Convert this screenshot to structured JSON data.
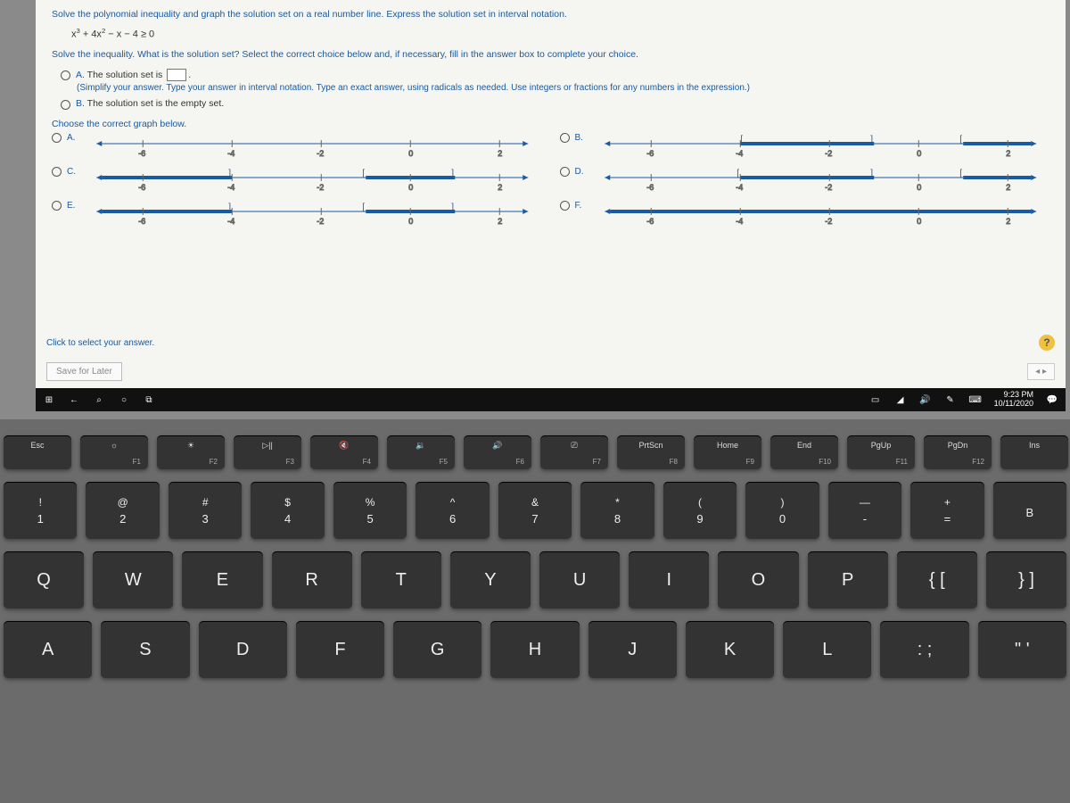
{
  "question": {
    "prompt": "Solve the polynomial inequality and graph the solution set on a real number line. Express the solution set in interval notation.",
    "equation_html": "x³ + 4x² − x − 4 ≥ 0",
    "sub_prompt": "Solve the inequality. What is the solution set? Select the correct choice below and, if necessary, fill in the answer box to complete your choice.",
    "choices": {
      "A_label": "A.",
      "A_text": "The solution set is",
      "A_hint": "(Simplify your answer. Type your answer in interval notation. Type an exact answer, using radicals as needed. Use integers or fractions for any numbers in the expression.)",
      "B_label": "B.",
      "B_text": "The solution set is the empty set."
    },
    "choose_graph": "Choose the correct graph below.",
    "graph_labels": {
      "A": "A.",
      "B": "B.",
      "C": "C.",
      "D": "D.",
      "E": "E.",
      "F": "F."
    },
    "axis_ticks": [
      -6,
      -4,
      -2,
      0,
      2
    ]
  },
  "footer": {
    "click_select": "Click to select your answer.",
    "save_later": "Save for Later",
    "help": "?",
    "nav": "◂  ▸"
  },
  "taskbar": {
    "time": "9:23 PM",
    "date": "10/11/2020"
  },
  "keyboard": {
    "fn": [
      {
        "top": "Esc",
        "sub": ""
      },
      {
        "top": "☼",
        "sub": "F1"
      },
      {
        "top": "☀",
        "sub": "F2"
      },
      {
        "top": "▷||",
        "sub": "F3"
      },
      {
        "top": "🔇",
        "sub": "F4"
      },
      {
        "top": "🔉",
        "sub": "F5"
      },
      {
        "top": "🔊",
        "sub": "F6"
      },
      {
        "top": "⎚",
        "sub": "F7"
      },
      {
        "top": "PrtScn",
        "sub": "F8"
      },
      {
        "top": "Home",
        "sub": "F9"
      },
      {
        "top": "End",
        "sub": "F10"
      },
      {
        "top": "PgUp",
        "sub": "F11"
      },
      {
        "top": "PgDn",
        "sub": "F12"
      },
      {
        "top": "Ins",
        "sub": ""
      }
    ],
    "row1": [
      {
        "t": "!",
        "b": "1"
      },
      {
        "t": "@",
        "b": "2"
      },
      {
        "t": "#",
        "b": "3"
      },
      {
        "t": "$",
        "b": "4"
      },
      {
        "t": "%",
        "b": "5"
      },
      {
        "t": "^",
        "b": "6"
      },
      {
        "t": "&",
        "b": "7"
      },
      {
        "t": "*",
        "b": "8"
      },
      {
        "t": "(",
        "b": "9"
      },
      {
        "t": ")",
        "b": "0"
      },
      {
        "t": "—",
        "b": "-"
      },
      {
        "t": "+",
        "b": "="
      },
      {
        "t": "",
        "b": "B"
      }
    ],
    "row2": [
      "Q",
      "W",
      "E",
      "R",
      "T",
      "Y",
      "U",
      "I",
      "O",
      "P",
      "{ [",
      "} ]"
    ],
    "row3": [
      "A",
      "S",
      "D",
      "F",
      "G",
      "H",
      "J",
      "K",
      "L",
      ": ;",
      "\" '"
    ]
  }
}
